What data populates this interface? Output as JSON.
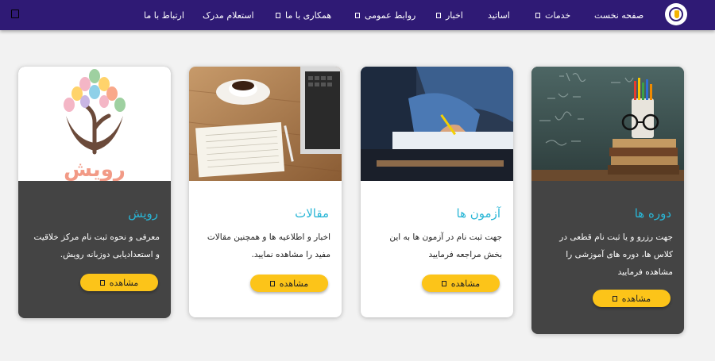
{
  "nav": {
    "items": [
      {
        "label": "صفحه نخست",
        "caret": false
      },
      {
        "label": "خدمات",
        "caret": true
      },
      {
        "label": "اساتید",
        "caret": false
      },
      {
        "label": "اخبار",
        "caret": true
      },
      {
        "label": "روابط عمومی",
        "caret": true
      },
      {
        "label": "همکاری با ما",
        "caret": true
      },
      {
        "label": "استعلام مدرک",
        "caret": false
      },
      {
        "label": "ارتباط با ما",
        "caret": false
      }
    ]
  },
  "cards": [
    {
      "title": "دوره ها",
      "description": "جهت رزرو و یا ثبت نام قطعی در کلاس ها، دوره های آموزشی را مشاهده فرمایید",
      "button_label": "مشاهده",
      "image": "books-pencils-glasses-photo",
      "theme": "dark"
    },
    {
      "title": "آزمون ها",
      "description": "جهت ثبت نام در آزمون ها به این بخش مراجعه فرمایید",
      "button_label": "مشاهده",
      "image": "student-writing-exam-photo",
      "theme": "light"
    },
    {
      "title": "مقالات",
      "description": "اخبار و اطلاعیه ها و همچنین مقالات مفید را مشاهده نمایید.",
      "button_label": "مشاهده",
      "image": "coffee-notebook-laptop-photo",
      "theme": "light"
    },
    {
      "title": "رویش",
      "description": "معرفی و نحوه ثبت نام مرکز خلاقیت و استعدادیابی دوزبانه رویش.",
      "button_label": "مشاهده",
      "image": "rooyesh-tree-logo",
      "logo_text": "رویش",
      "theme": "dark"
    }
  ],
  "colors": {
    "navbar": "#2f1a75",
    "title": "#29b6d6",
    "button": "#fcc419",
    "dark_card": "#444444"
  }
}
